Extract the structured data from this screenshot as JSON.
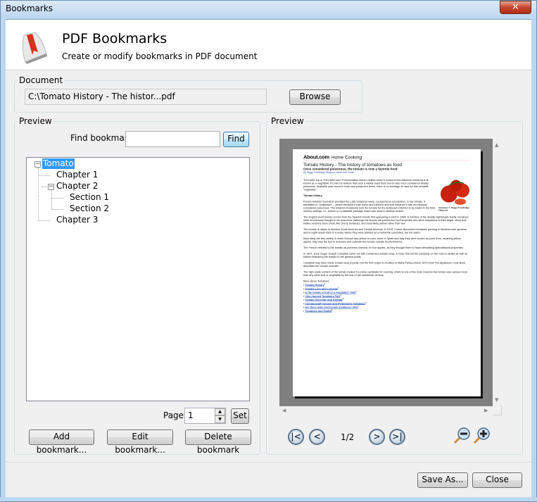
{
  "window": {
    "title": "Bookmarks",
    "close": "✕"
  },
  "header": {
    "title": "PDF Bookmarks",
    "subtitle": "Create or modify bookmarks in PDF document"
  },
  "document": {
    "label": "Document",
    "path": "C:\\Tomato History - The histor...pdf",
    "browse": "Browse"
  },
  "left": {
    "label": "Preview",
    "find_label": "Find bookmark:",
    "find_value": "",
    "find_button": "Find",
    "tree": [
      {
        "label": "Tomato",
        "level": 0,
        "selected": true
      },
      {
        "label": "Chapter 1",
        "level": 1
      },
      {
        "label": "Chapter 2",
        "level": 1
      },
      {
        "label": "Section 1",
        "level": 2
      },
      {
        "label": "Section 2",
        "level": 2
      },
      {
        "label": "Chapter 3",
        "level": 1
      }
    ],
    "page_label": "Page:",
    "page_value": "1",
    "set": "Set",
    "add": "Add bookmark...",
    "edit": "Edit bookmark...",
    "delete": "Delete bookmark"
  },
  "right": {
    "label": "Preview",
    "page_indicator": "1/2",
    "pdf": {
      "logo": "About.com",
      "section": "Home Cooking",
      "title": "Tomato History - The history of tomatoes as food",
      "subtitle": "Once considered poisonous, the tomato is now a favorite food",
      "byline": "By Peggy Trowbridge Filippone, About.com Guide",
      "p1": "TUH-MAY-toh or TUH-MAH-toh? Pronunciation doesn't matter when it comes to this fabulous nutritious fruit known as a vegetable. It's hard to believe that such a widely-used food source was once considered deadly poisonous. Available year-round in fresh and preserved forms, there is no shortage of uses for this versatile \"vegetable.\"",
      "h1": "Tomato history",
      "p2": "French botanist Tournefort provided the Latin botanical name, Lycopersicon esculentum, to the tomato. It translates to \"wolfpeach\" -- peach because it was round and luscious and wolf because it was erroneously considered poisonous. The botanist mistakenly took the tomato for the wolfpeach referred to by Galen in his third century writings, i.e., poison in a palatable package which was used to destroy wolves.",
      "caption": "Tomatoes © Peggy Trowbridge Filippone",
      "p3": "The English word tomato comes from the Spanish tomatl, first appearing in print in 1595. A member of the deadly nightshade family, tomatoes were erroneously thought to be poisonous (although the leaves are poisonous) by Europeans who were suspicious of their bright, shiny fruit. Native versions were small, like cherry tomatoes, and most likely yellow rather than red.",
      "p4": "The tomato is native to western South America and Central America. In 1519, Cortez discovered tomatoes growing in Montezuma's gardens and brought seeds back to Europe where they were planted as ornamental curiosities, but not eaten.",
      "p5": "Most likely the first variety to reach Europe was yellow in color, since in Spain and Italy they were known as pomi d'oro, meaning yellow apples. Italy was the first to embrace and cultivate the tomato outside South America.",
      "p6": "The French referred to the tomato as pommes d'amour, or love apples, as they thought them to have stimulating aphrodisiacal properties.",
      "p7": "In 1897, soup mogul Joseph Campbell came out with condensed tomato soup, a move that set the company on the road to wealth as well as further endearing the tomato to the general public.",
      "p8": "Campbell may have made tomato soup popular, but the first recipe is credited to Maria Parloa whose 1872 book The Appledore Cook Book describes her tomato chowder.",
      "p9": "The high acidic content of the tomato makes it a prime candidate for canning, which is one of the main reasons the tomato was canned more than any other fruit or vegetable by the end of the nineteenth century.",
      "more": "More about Tomatoes:",
      "links": [
        "Tomato History",
        "Tomato Lore and Legends",
        "Is the tomato a fruit or a vegetable? FAQ",
        "Vine-ripened Tomatoes FAQ",
        "Tomato Selection and Storage",
        "Commercially-Grown and Hydroponic Tomatoes",
        "Are there male and female tomatoes? FAQ",
        "Tomatoes and Health"
      ]
    }
  },
  "footer": {
    "save_as": "Save As...",
    "close": "Close"
  },
  "colors": {
    "selection": "#3399ff",
    "link": "#2a52be"
  }
}
